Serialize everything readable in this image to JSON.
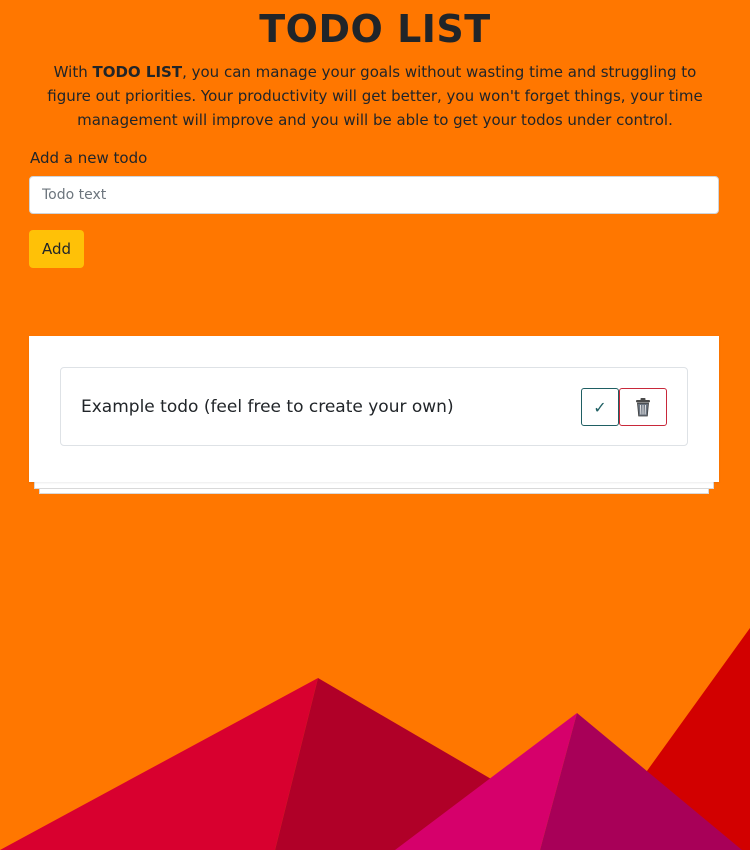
{
  "header": {
    "title": "TODO LIST",
    "intro_prefix": "With ",
    "intro_bold": "TODO LIST",
    "intro_rest": ", you can manage your goals without wasting time and struggling to figure out priorities. Your productivity will get better, you won't forget things, your time management will improve and you will be able to get your todos under control."
  },
  "form": {
    "label": "Add a new todo",
    "input_value": "",
    "input_placeholder": "Todo text",
    "add_label": "Add"
  },
  "todos": [
    {
      "text": "Example todo (feel free to create your own)",
      "done_icon": "check-icon",
      "done_glyph": "✓",
      "delete_icon": "trash-icon"
    }
  ],
  "colors": {
    "background": "#ff7700",
    "add_button": "#ffc107",
    "done_border": "#1f5f63",
    "delete_border": "#c8283a",
    "mountain_red_light": "#d8002f",
    "mountain_red_dark": "#b00028",
    "mountain_pink_light": "#d6006b",
    "mountain_pink_dark": "#a80058",
    "mountain_right": "#d20000"
  }
}
